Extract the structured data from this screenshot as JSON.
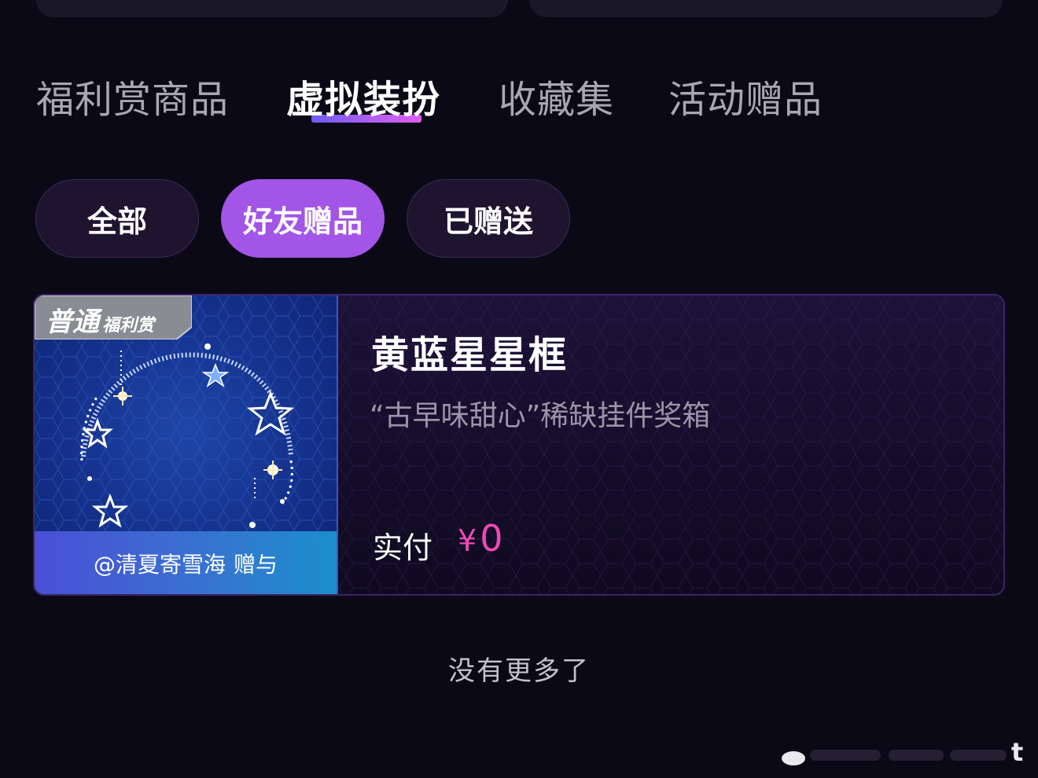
{
  "tabs": [
    {
      "label": "福利赏商品"
    },
    {
      "label": "虚拟装扮"
    },
    {
      "label": "收藏集"
    },
    {
      "label": "活动赠品"
    }
  ],
  "active_tab": "虚拟装扮",
  "filters": [
    {
      "label": "全部"
    },
    {
      "label": "好友赠品"
    },
    {
      "label": "已赠送"
    }
  ],
  "active_filter": "好友赠品",
  "item": {
    "badge_main": "普通",
    "badge_sub": "福利赏",
    "title": "黄蓝星星框",
    "subtitle": "“古早味甜心”稀缺挂件奖箱",
    "gift_from": "@清夏寄雪海",
    "gift_suffix": "赠与",
    "price_label": "实付",
    "price_currency": "¥",
    "price_value": "0"
  },
  "footer": {
    "no_more": "没有更多了"
  },
  "watermark": {
    "visible_letter": "t"
  },
  "colors": {
    "background": "#0c0916",
    "accent_purple": "#a255e6",
    "price_pink": "#ee49b4",
    "gift_bar_blue": "#3872d0"
  }
}
